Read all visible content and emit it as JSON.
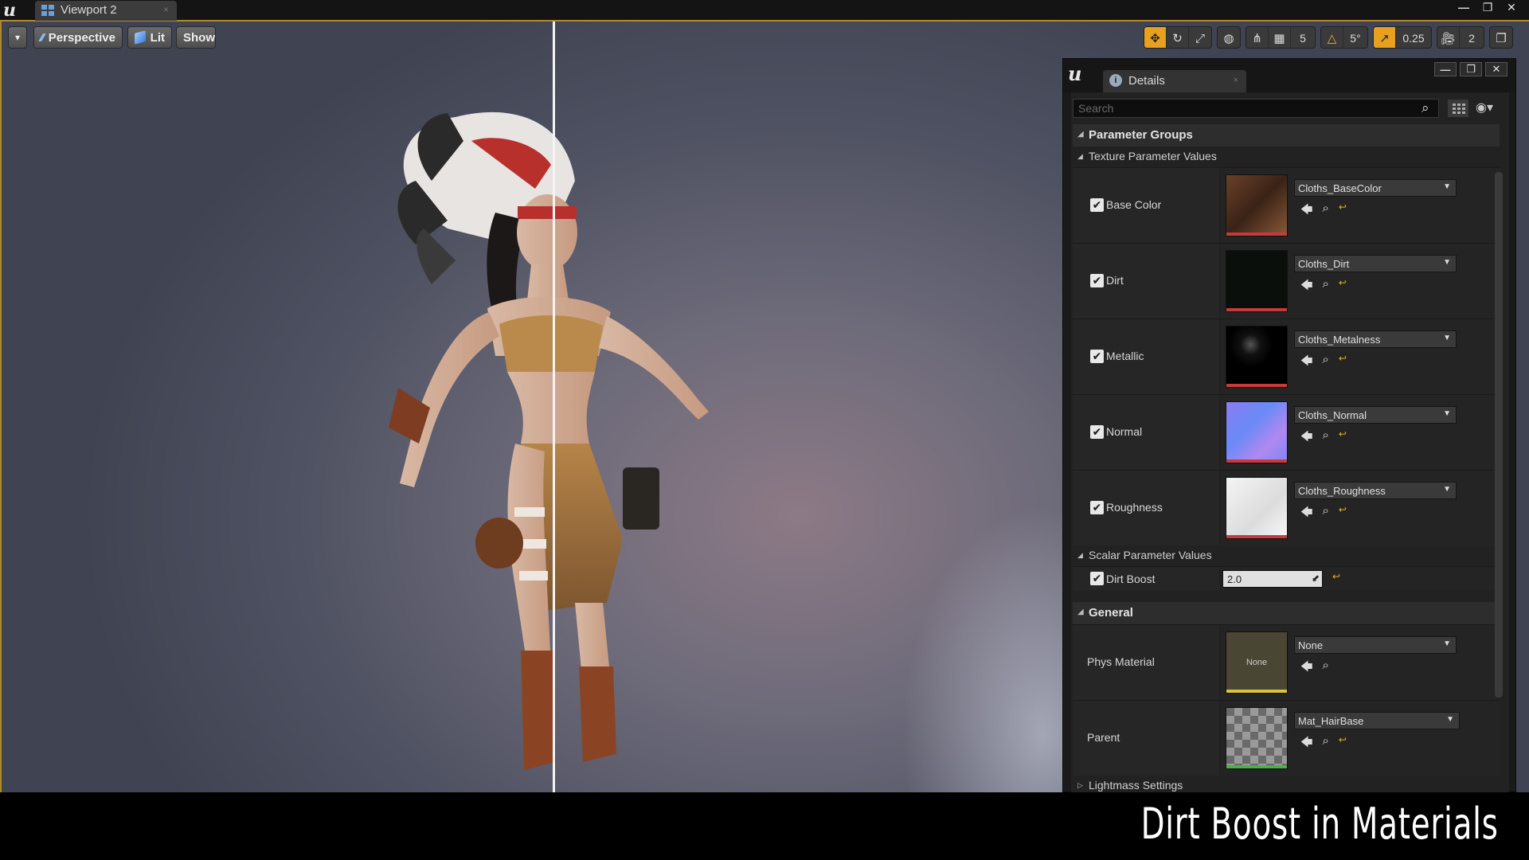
{
  "titlebar": {
    "tab_label": "Viewport 2",
    "tab_close": "×",
    "window_buttons": {
      "minimize": "—",
      "restore": "❐",
      "close": "✕"
    }
  },
  "viewport": {
    "menu_glyph": "▾",
    "perspective_label": "Perspective",
    "lit_label": "Lit",
    "show_label": "Show",
    "grid_snap_value": "5",
    "rotation_snap_value": "5°",
    "scale_snap_value": "0.25",
    "camera_speed_value": "2"
  },
  "details": {
    "tab_label": "Details",
    "tab_close": "×",
    "window_buttons": {
      "minimize": "—",
      "restore": "❐",
      "close": "✕"
    },
    "search_placeholder": "Search",
    "parameter_groups_label": "Parameter Groups",
    "texture_values_label": "Texture Parameter Values",
    "textures": [
      {
        "label": "Base Color",
        "asset": "Cloths_BaseColor"
      },
      {
        "label": "Dirt",
        "asset": "Cloths_Dirt"
      },
      {
        "label": "Metallic",
        "asset": "Cloths_Metalness"
      },
      {
        "label": "Normal",
        "asset": "Cloths_Normal"
      },
      {
        "label": "Roughness",
        "asset": "Cloths_Roughness"
      }
    ],
    "scalar_values_label": "Scalar Parameter Values",
    "scalar": {
      "label": "Dirt Boost",
      "value": "2.0"
    },
    "general_label": "General",
    "phys_material": {
      "label": "Phys Material",
      "asset": "None",
      "thumb_text": "None"
    },
    "parent": {
      "label": "Parent",
      "asset": "Mat_HairBase"
    },
    "lightmass_label": "Lightmass Settings"
  },
  "caption": "Dirt Boost in Materials"
}
